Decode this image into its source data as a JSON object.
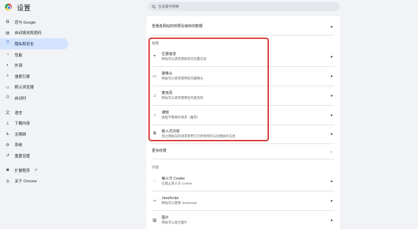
{
  "app": {
    "title": "设置"
  },
  "search": {
    "placeholder": "在设置中搜索"
  },
  "sidebar": {
    "items": [
      {
        "label": "您与 Google",
        "icon": "google-icon",
        "glyph": "G"
      },
      {
        "label": "自动填充和密码",
        "icon": "autofill-icon",
        "glyph": "▤"
      },
      {
        "label": "隐私和安全",
        "icon": "shield-icon",
        "glyph": "⛉",
        "active": true
      },
      {
        "label": "性能",
        "icon": "speedometer-icon",
        "glyph": "◔"
      },
      {
        "label": "外观",
        "icon": "palette-icon",
        "glyph": "◐"
      },
      {
        "label": "搜索引擎",
        "icon": "search-icon",
        "glyph": "⌕"
      },
      {
        "label": "默认浏览器",
        "icon": "browser-icon",
        "glyph": "▭"
      },
      {
        "label": "启动时",
        "icon": "power-icon",
        "glyph": "⏻"
      },
      {
        "label": "语言",
        "icon": "translate-icon",
        "glyph": "文"
      },
      {
        "label": "下载内容",
        "icon": "download-icon",
        "glyph": "⤓"
      },
      {
        "label": "无障碍",
        "icon": "accessibility-icon",
        "glyph": "♿"
      },
      {
        "label": "系统",
        "icon": "wrench-icon",
        "glyph": "⚙"
      },
      {
        "label": "重置设置",
        "icon": "reset-icon",
        "glyph": "↺"
      },
      {
        "label": "扩展程序",
        "icon": "extensions-icon",
        "glyph": "✱",
        "external": "↗"
      },
      {
        "label": "关于 Chrome",
        "icon": "chrome-icon",
        "glyph": "◎"
      }
    ]
  },
  "panel": {
    "top_row": {
      "label": "查看各网站的权限及储存的数据",
      "arrow": "▸"
    },
    "permissions_heading": "权限",
    "permissions": [
      {
        "title": "位置信息",
        "subtitle": "网站可以请求获取您的位置信息",
        "icon": "location-icon",
        "glyph": "⌖"
      },
      {
        "title": "摄像头",
        "subtitle": "网站可以请求使用您的摄像头",
        "icon": "camera-icon",
        "glyph": "▭"
      },
      {
        "title": "麦克风",
        "subtitle": "网站可以请求使用您的麦克风",
        "icon": "microphone-icon",
        "glyph": "♫"
      },
      {
        "title": "通知",
        "subtitle": "收起不需要的请求（推荐）",
        "icon": "bell-icon",
        "glyph": "♪"
      },
      {
        "title": "嵌入式内容",
        "subtitle": "禁止网站向您请求使用它们所保存的与您相关的信息",
        "icon": "embedded-content-icon",
        "glyph": "⧉"
      }
    ],
    "more_permissions": {
      "label": "更多权限",
      "arrow": "⌄"
    },
    "content_heading": "内容",
    "content": [
      {
        "title": "第三方 Cookie",
        "subtitle": "已阻止第三方 Cookie",
        "icon": "cookie-icon",
        "glyph": "◌"
      },
      {
        "title": "JavaScript",
        "subtitle": "网站可以使用 JavaScript",
        "icon": "code-icon",
        "glyph": "‹›"
      },
      {
        "title": "图片",
        "subtitle": "网站可以显示图片",
        "icon": "image-icon",
        "glyph": "▨"
      }
    ]
  },
  "colors": {
    "highlight": "#d93a3a",
    "active_nav": "#d3e3fd",
    "background": "#f1f3f6"
  }
}
